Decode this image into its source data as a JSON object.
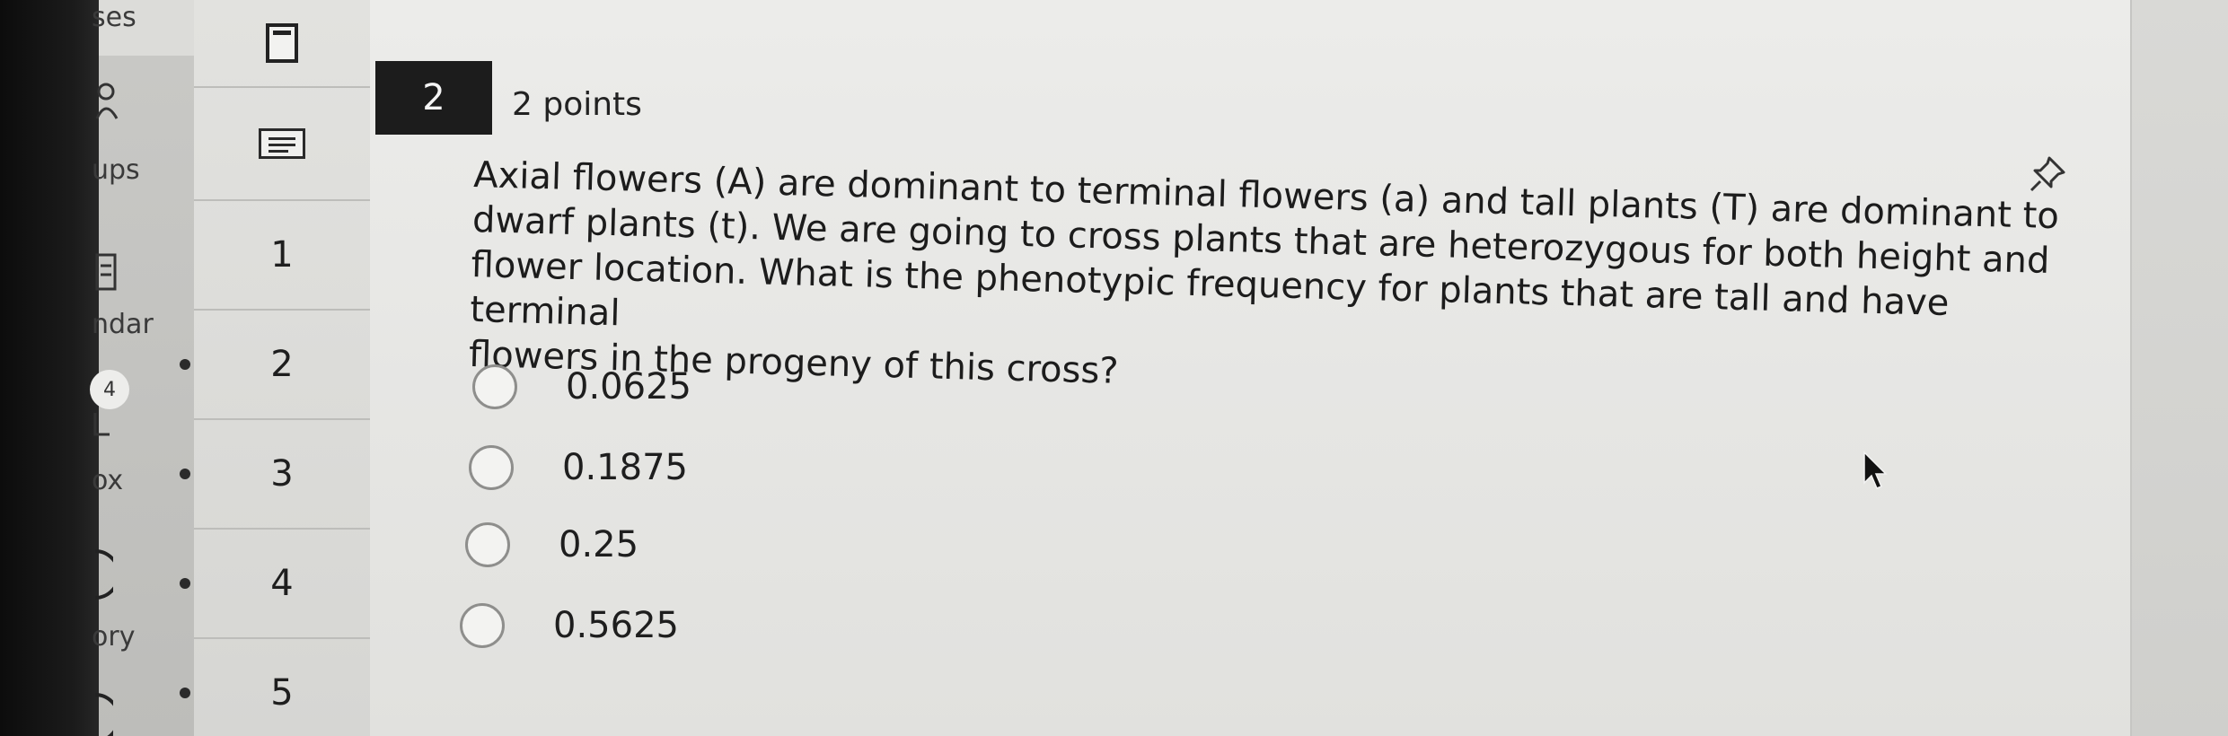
{
  "global_nav": {
    "items": [
      {
        "label": "ses"
      },
      {
        "label": "ups"
      },
      {
        "label": "ndar"
      },
      {
        "label": "ox"
      },
      {
        "label": "ory"
      }
    ],
    "inbox_badge": "4"
  },
  "question_nav": {
    "items": [
      "1",
      "2",
      "3",
      "4",
      "5"
    ]
  },
  "question": {
    "number": "2",
    "points": "2 points",
    "lines": [
      "Axial flowers (A) are dominant to terminal flowers (a) and tall plants (T) are dominant to",
      "dwarf plants (t). We are going to cross plants that are heterozygous for both height and",
      "flower location. What is the phenotypic frequency for plants that are tall and have terminal",
      "flowers in the progeny of this cross?"
    ],
    "options": [
      "0.0625",
      "0.1875",
      "0.25",
      "0.5625"
    ]
  },
  "icons": {
    "pin": "pin-icon",
    "cursor": "mouse-pointer-icon"
  }
}
